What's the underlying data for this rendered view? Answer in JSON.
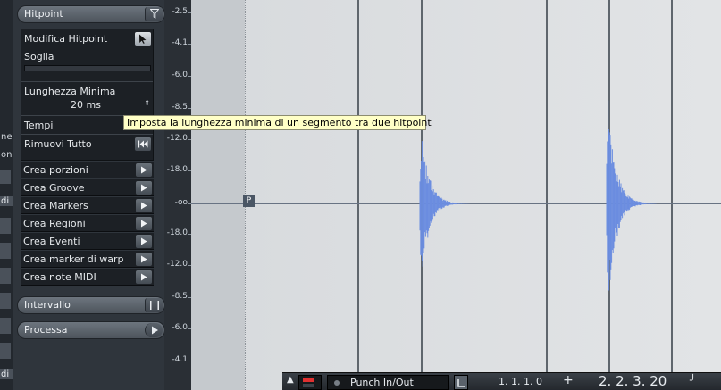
{
  "left_sliver": {
    "items": [
      "ne",
      "one",
      "di",
      "di"
    ]
  },
  "inspector": {
    "hitpoint_header": "Hitpoint",
    "hitpoint_filter_icon": "filter-icon",
    "edit_hitpoint_label": "Modifica Hitpoint",
    "threshold_label": "Soglia",
    "min_length_label": "Lunghezza Minima",
    "min_length_value": "20 ms",
    "beats_label": "Tempi",
    "remove_all_label": "Rimuovi Tutto",
    "actions": [
      "Crea porzioni",
      "Crea Groove",
      "Crea Markers",
      "Crea Regioni",
      "Crea Eventi",
      "Crea marker di warp",
      "Crea note MIDI"
    ],
    "range_header": "Intervallo",
    "process_header": "Processa"
  },
  "ruler": {
    "labels": [
      "-2.5",
      "-4.1",
      "-6.0",
      "-8.5",
      "-12.0",
      "-18.0",
      "-oo",
      "-18.0",
      "-12.0",
      "-8.5",
      "-6.0",
      "-4.1"
    ]
  },
  "editor": {
    "marker_label": "P"
  },
  "tooltip": {
    "text": "Imposta la lunghezza minima di un segmento tra due hitpoint"
  },
  "transport": {
    "punch_label": "Punch In/Out",
    "left_locator": "1.  1.  1.   0",
    "position": "2.  2.  3.  20",
    "plus_label": "+"
  },
  "colors": {
    "waveform": "#6b8de0",
    "tooltip_bg": "#ffffc6",
    "panel_bg": "#2f353c"
  }
}
